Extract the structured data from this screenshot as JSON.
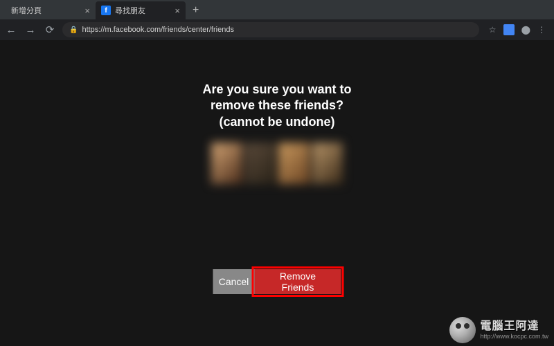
{
  "browser": {
    "tabs": [
      {
        "title": "新增分頁",
        "active": false,
        "favicon": false
      },
      {
        "title": "尋找朋友",
        "active": true,
        "favicon": true
      }
    ],
    "url": "https://m.facebook.com/friends/center/friends"
  },
  "dialog": {
    "heading_line1": "Are you sure you want to",
    "heading_line2": "remove these friends?",
    "heading_line3": "(cannot be undone)",
    "cancel_label": "Cancel",
    "remove_label": "Remove Friends"
  },
  "watermark": {
    "title": "電腦王阿達",
    "subtitle": "http://www.kocpc.com.tw"
  }
}
